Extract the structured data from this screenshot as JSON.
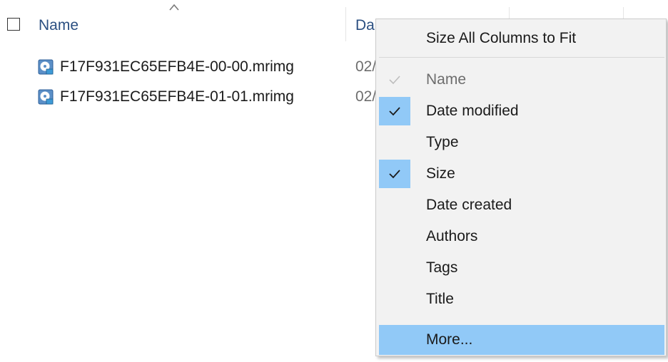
{
  "header": {
    "name_label": "Name",
    "date_label": "Da"
  },
  "files": [
    {
      "name": "F17F931EC65EFB4E-00-00.mrimg",
      "date": "02/",
      "icon": "disk-image-icon"
    },
    {
      "name": "F17F931EC65EFB4E-01-01.mrimg",
      "date": "02/",
      "icon": "disk-image-icon"
    }
  ],
  "context_menu": {
    "size_all": "Size All Columns to Fit",
    "items": [
      {
        "label": "Name",
        "checked": true,
        "disabled": true
      },
      {
        "label": "Date modified",
        "checked": true,
        "disabled": false
      },
      {
        "label": "Type",
        "checked": false,
        "disabled": false
      },
      {
        "label": "Size",
        "checked": true,
        "disabled": false
      },
      {
        "label": "Date created",
        "checked": false,
        "disabled": false
      },
      {
        "label": "Authors",
        "checked": false,
        "disabled": false
      },
      {
        "label": "Tags",
        "checked": false,
        "disabled": false
      },
      {
        "label": "Title",
        "checked": false,
        "disabled": false
      },
      {
        "label": "More...",
        "checked": false,
        "disabled": false,
        "hovered": true
      }
    ]
  },
  "colors": {
    "header_text": "#2b4f81",
    "highlight": "#91c9f7",
    "menu_bg": "#f2f2f2"
  }
}
